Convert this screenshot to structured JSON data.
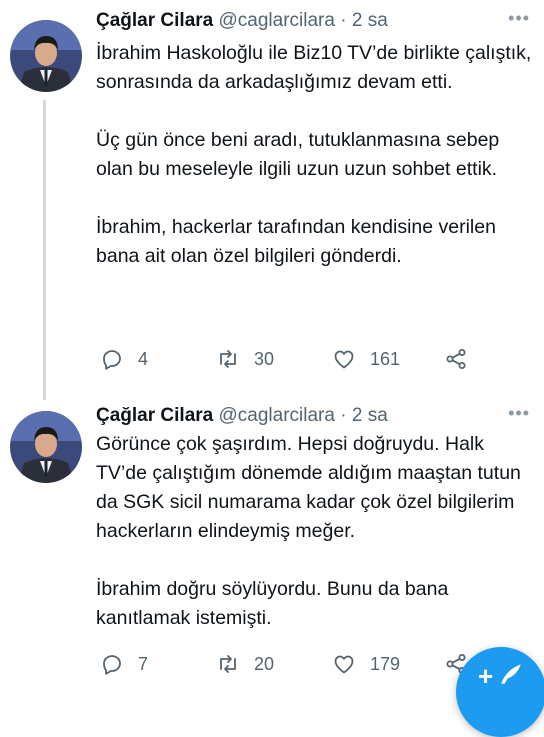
{
  "tweets": [
    {
      "name": "Çağlar Cilara",
      "handle": "@caglarcilara",
      "separator": "·",
      "time": "2 sa",
      "paragraphs": [
        "İbrahim Haskoloğlu ile Biz10 TV’de birlikte çalıştık, sonrasında da arkadaşlığımız devam etti.",
        "Üç gün önce beni aradı, tutuklanmasına sebep olan bu meseleyle ilgili uzun uzun sohbet ettik.",
        "İbrahim, hackerlar tarafından kendisine verilen bana ait olan özel bilgileri gönderdi."
      ],
      "replies": "4",
      "retweets": "30",
      "likes": "161"
    },
    {
      "name": "Çağlar Cilara",
      "handle": "@caglarcilara",
      "separator": "·",
      "time": "2 sa",
      "paragraphs": [
        "Görünce çok şaşırdım. Hepsi doğruydu. Halk TV’de çalıştığım dönemde aldığım maaştan tutun da SGK sicil numarama kadar çok özel bilgilerim hackerların elindeymiş meğer.",
        "İbrahim doğru söylüyordu. Bunu da bana kanıtlamak istemişti."
      ],
      "replies": "7",
      "retweets": "20",
      "likes": "179"
    }
  ],
  "icons": {
    "reply": "reply-icon",
    "retweet": "retweet-icon",
    "like": "heart-icon",
    "share": "share-icon",
    "more": "more-icon",
    "compose": "compose-icon"
  },
  "colors": {
    "text": "#0f1419",
    "secondary": "#536471",
    "thread_line": "#cfd9de",
    "accent": "#1d9bf0"
  }
}
